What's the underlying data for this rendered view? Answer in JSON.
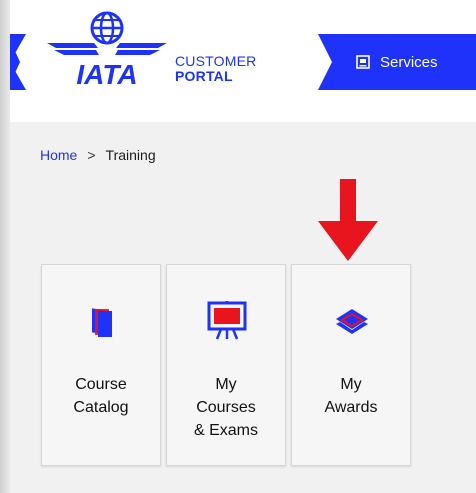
{
  "header": {
    "logo_text": "IATA",
    "portal_line1": "CUSTOMER",
    "portal_line2": "PORTAL",
    "nav_services_label": "Services"
  },
  "breadcrumb": {
    "home": "Home",
    "separator": ">",
    "current": "Training"
  },
  "tiles": [
    {
      "label": "Course\nCatalog",
      "icon": "catalog-icon"
    },
    {
      "label": "My\nCourses\n& Exams",
      "icon": "easel-icon"
    },
    {
      "label": "My\nAwards",
      "icon": "layers-icon"
    }
  ],
  "colors": {
    "brand_blue": "#1e32fa",
    "arrow_red": "#e8141e",
    "catalog_red": "#e8141e"
  }
}
